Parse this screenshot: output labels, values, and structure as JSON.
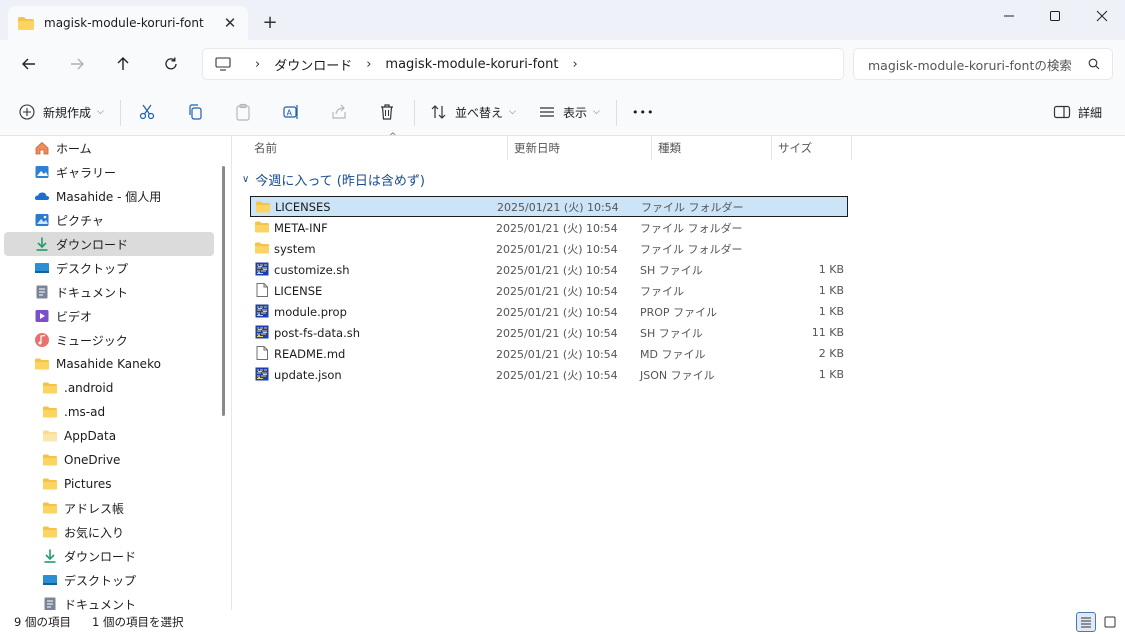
{
  "window": {
    "tab_title": "magisk-module-koruri-font",
    "new_tab": "+"
  },
  "address": {
    "crumbs": [
      "ダウンロード",
      "magisk-module-koruri-font"
    ],
    "search_placeholder": "magisk-module-koruri-fontの検索"
  },
  "toolbar": {
    "new_label": "新規作成",
    "sort_label": "並べ替え",
    "view_label": "表示",
    "more_label": "•••",
    "details_label": "詳細"
  },
  "sidebar": {
    "items": [
      {
        "label": "ホーム",
        "icon": "home-icon"
      },
      {
        "label": "ギャラリー",
        "icon": "gallery-icon"
      },
      {
        "label": "Masahide - 個人用",
        "icon": "onedrive-icon"
      },
      {
        "label": "ピクチャ",
        "icon": "pictures-icon"
      },
      {
        "label": "ダウンロード",
        "icon": "download-icon"
      },
      {
        "label": "デスクトップ",
        "icon": "desktop-icon"
      },
      {
        "label": "ドキュメント",
        "icon": "documents-icon"
      },
      {
        "label": "ビデオ",
        "icon": "videos-icon"
      },
      {
        "label": "ミュージック",
        "icon": "music-icon"
      },
      {
        "label": "Masahide Kaneko",
        "icon": "folder-icon"
      },
      {
        "label": ".android",
        "icon": "folder-icon"
      },
      {
        "label": ".ms-ad",
        "icon": "folder-icon"
      },
      {
        "label": "AppData",
        "icon": "folder-icon"
      },
      {
        "label": "OneDrive",
        "icon": "folder-icon"
      },
      {
        "label": "Pictures",
        "icon": "folder-icon"
      },
      {
        "label": "アドレス帳",
        "icon": "folder-icon"
      },
      {
        "label": "お気に入り",
        "icon": "folder-icon"
      },
      {
        "label": "ダウンロード",
        "icon": "download-icon"
      },
      {
        "label": "デスクトップ",
        "icon": "desktop-icon"
      },
      {
        "label": "ドキュメント",
        "icon": "documents-icon"
      }
    ]
  },
  "columns": {
    "name": "名前",
    "date": "更新日時",
    "type": "種類",
    "size": "サイズ"
  },
  "group": {
    "label": "今週に入って (昨日は含めず)"
  },
  "files": [
    {
      "name": "LICENSES",
      "date": "2025/01/21 (火) 10:54",
      "type": "ファイル フォルダー",
      "size": "",
      "icon": "folder-icon"
    },
    {
      "name": "META-INF",
      "date": "2025/01/21 (火) 10:54",
      "type": "ファイル フォルダー",
      "size": "",
      "icon": "folder-icon"
    },
    {
      "name": "system",
      "date": "2025/01/21 (火) 10:54",
      "type": "ファイル フォルダー",
      "size": "",
      "icon": "folder-icon"
    },
    {
      "name": "customize.sh",
      "date": "2025/01/21 (火) 10:54",
      "type": "SH ファイル",
      "size": "1 KB",
      "icon": "script-file-icon"
    },
    {
      "name": "LICENSE",
      "date": "2025/01/21 (火) 10:54",
      "type": "ファイル",
      "size": "1 KB",
      "icon": "blank-file-icon"
    },
    {
      "name": "module.prop",
      "date": "2025/01/21 (火) 10:54",
      "type": "PROP ファイル",
      "size": "1 KB",
      "icon": "script-file-icon"
    },
    {
      "name": "post-fs-data.sh",
      "date": "2025/01/21 (火) 10:54",
      "type": "SH ファイル",
      "size": "11 KB",
      "icon": "script-file-icon"
    },
    {
      "name": "README.md",
      "date": "2025/01/21 (火) 10:54",
      "type": "MD ファイル",
      "size": "2 KB",
      "icon": "blank-file-icon"
    },
    {
      "name": "update.json",
      "date": "2025/01/21 (火) 10:54",
      "type": "JSON ファイル",
      "size": "1 KB",
      "icon": "script-file-icon"
    }
  ],
  "status": {
    "count": "9 個の項目",
    "selected": "1 個の項目を選択"
  }
}
